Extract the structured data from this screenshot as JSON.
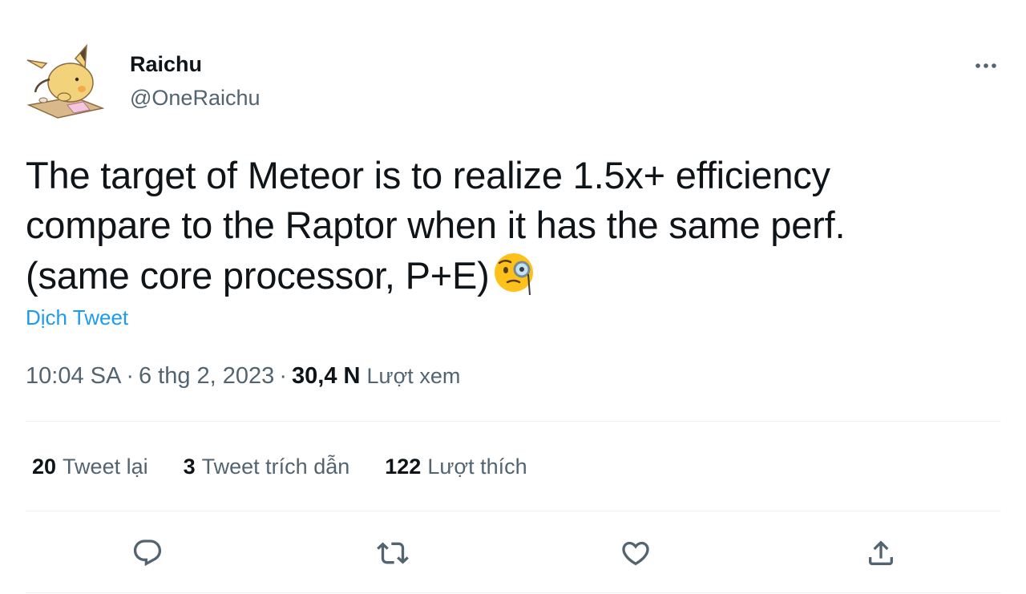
{
  "author": {
    "display_name": "Raichu",
    "handle": "@OneRaichu",
    "avatar_icon": "raichu-avatar"
  },
  "tweet": {
    "lines": [
      "The target of Meteor is to realize 1.5x+ efficiency",
      "compare to the Raptor when it has the same perf.",
      "(same core processor, P+E)"
    ],
    "emoji": "monocle-face-emoji",
    "translate_label": "Dịch Tweet"
  },
  "meta": {
    "time": "10:04 SA",
    "separator": "·",
    "date": "6 thg 2, 2023",
    "views_count": "30,4 N",
    "views_label": "Lượt xem"
  },
  "stats": {
    "retweets": {
      "count": "20",
      "label": "Tweet lại"
    },
    "quotes": {
      "count": "3",
      "label": "Tweet trích dẫn"
    },
    "likes": {
      "count": "122",
      "label": "Lượt thích"
    }
  },
  "icons": {
    "more": "more-icon",
    "reply": "reply-icon",
    "retweet": "retweet-icon",
    "like": "like-icon",
    "share": "share-icon"
  },
  "colors": {
    "text_primary": "#0f1419",
    "text_secondary": "#536471",
    "link": "#1d9bf0",
    "divider": "#eff3f4"
  }
}
